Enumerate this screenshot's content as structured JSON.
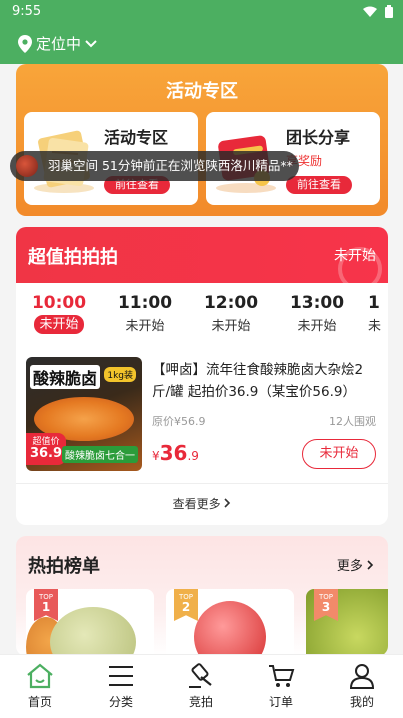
{
  "status": {
    "time": "9:55"
  },
  "header": {
    "location": "定位中"
  },
  "activity": {
    "title": "活动专区",
    "cards": [
      {
        "title": "活动专区",
        "subtitle": "",
        "button": "前往查看"
      },
      {
        "title": "团长分享",
        "subtitle": "享奖励",
        "button": "前往查看"
      }
    ]
  },
  "toast": {
    "text": "羽巢空间 51分钟前正在浏览陕西洛川精品**"
  },
  "auction": {
    "title": "超值拍拍拍",
    "status": "未开始",
    "slots": [
      {
        "time": "10:00",
        "status": "未开始"
      },
      {
        "time": "11:00",
        "status": "未开始"
      },
      {
        "time": "12:00",
        "status": "未开始"
      },
      {
        "time": "13:00",
        "status": "未开始"
      },
      {
        "time": "1",
        "status": "未"
      }
    ],
    "product": {
      "image_title": "酸辣脆卤",
      "image_badge": "1kg装",
      "image_tag_label": "超值价",
      "image_tag_price": "36.9",
      "image_tag2": "酸辣脆卤七合一",
      "name": "【呷卤】流年往食酸辣脆卤大杂烩2斤/罐 起拍价36.9（某宝价56.9）",
      "original_price": "原价¥56.9",
      "watchers": "12人围观",
      "currency": "¥",
      "price_int": "36",
      "price_dec": ".9",
      "button": "未开始"
    },
    "more": "查看更多"
  },
  "hot": {
    "title": "热拍榜单",
    "more": "更多",
    "items": [
      {
        "rank_label": "TOP",
        "rank": "1"
      },
      {
        "rank_label": "TOP",
        "rank": "2"
      },
      {
        "rank_label": "TOP",
        "rank": "3"
      }
    ]
  },
  "tabbar": {
    "items": [
      {
        "label": "首页",
        "icon": "home-icon"
      },
      {
        "label": "分类",
        "icon": "list-icon"
      },
      {
        "label": "竞拍",
        "icon": "gavel-icon"
      },
      {
        "label": "订单",
        "icon": "cart-icon"
      },
      {
        "label": "我的",
        "icon": "user-icon"
      }
    ]
  },
  "colors": {
    "green": "#4caf61",
    "red": "#e8293a",
    "orange": "#f28a2a"
  }
}
